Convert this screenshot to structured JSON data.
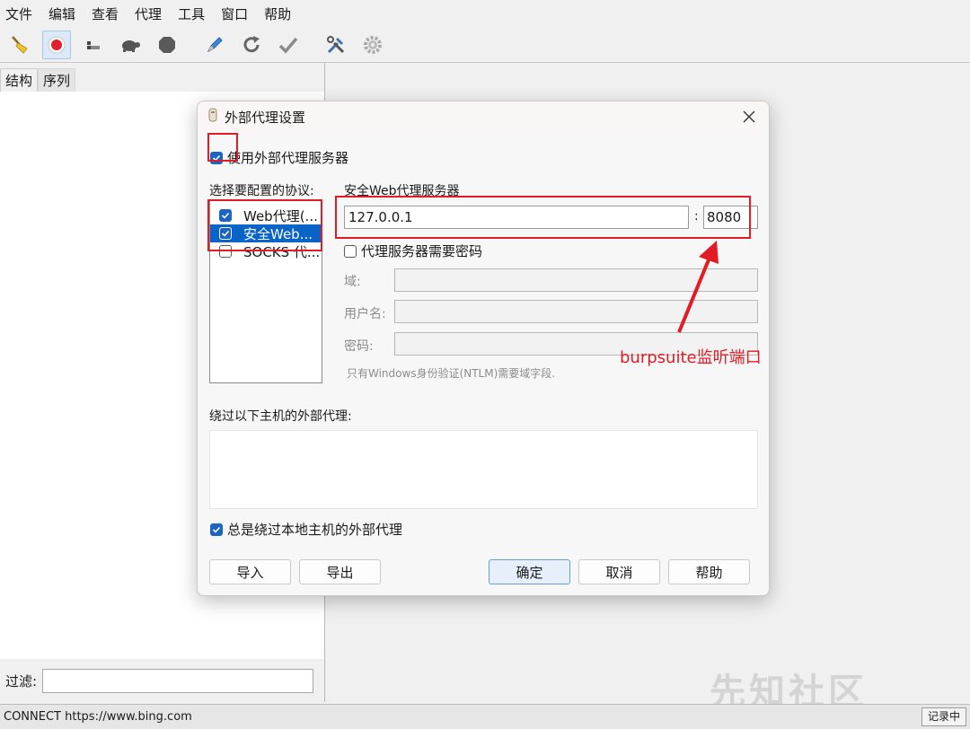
{
  "menu": [
    "文件",
    "编辑",
    "查看",
    "代理",
    "工具",
    "窗口",
    "帮助"
  ],
  "left": {
    "tabs": [
      "结构",
      "序列"
    ],
    "filter_label": "过滤:"
  },
  "status": {
    "text": "CONNECT https://www.bing.com",
    "recording": "记录中"
  },
  "watermark": "先知社区",
  "dialog": {
    "title": "外部代理设置",
    "use_proxy_label": "使用外部代理服务器",
    "use_proxy_checked": true,
    "protocols_label": "选择要配置的协议:",
    "protocols": [
      {
        "label": "Web代理(...",
        "checked": true,
        "selected": false
      },
      {
        "label": "安全Web...",
        "checked": true,
        "selected": true
      },
      {
        "label": "SOCKS 代...",
        "checked": false,
        "selected": false
      }
    ],
    "server_label": "安全Web代理服务器",
    "host": "127.0.0.1",
    "colon": ":",
    "port": "8080",
    "auth_label": "代理服务器需要密码",
    "auth_checked": false,
    "domain_label": "域:",
    "username_label": "用户名:",
    "password_label": "密码:",
    "ntlm_note": "只有Windows身份验证(NTLM)需要域字段.",
    "bypass_label": "绕过以下主机的外部代理:",
    "bypass_local_label": "总是绕过本地主机的外部代理",
    "bypass_local_checked": true,
    "buttons": {
      "import": "导入",
      "export": "导出",
      "ok": "确定",
      "cancel": "取消",
      "help": "帮助"
    }
  },
  "annotation": {
    "text": "burpsuite监听端口",
    "color": "#e21c24"
  },
  "colors": {
    "accent": "#1a64c4",
    "selection": "#0a64c8",
    "annotation_red": "#e21c24"
  },
  "toolbar_icons": [
    "broom-icon",
    "record-icon",
    "throttle-icon",
    "turtle-icon",
    "stop-icon",
    "pen-icon",
    "refresh-icon",
    "check-icon",
    "tools-icon",
    "gear-icon"
  ]
}
